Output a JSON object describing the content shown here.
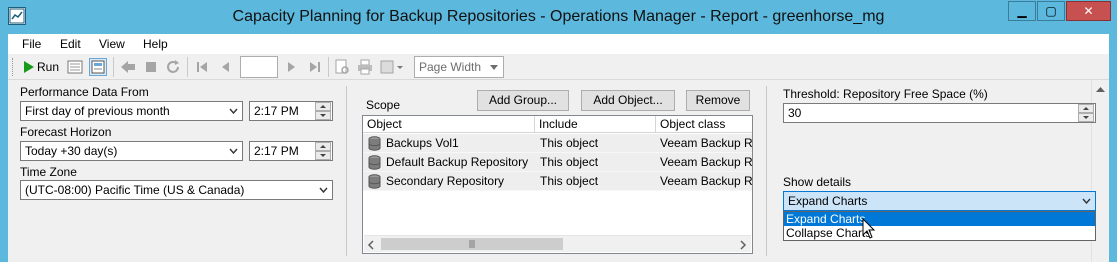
{
  "window": {
    "title": "Capacity Planning for Backup Repositories - Operations Manager - Report - greenhorse_mg",
    "minimize": "▁",
    "maximize": "▢",
    "close": "✕"
  },
  "menu": [
    "File",
    "Edit",
    "View",
    "Help"
  ],
  "toolbar": {
    "run_label": "Run",
    "page_number": "",
    "zoom_value": "Page Width"
  },
  "left_panel": {
    "perf_label": "Performance Data From",
    "perf_value": "First day of previous month",
    "perf_time": "2:17 PM",
    "forecast_label": "Forecast Horizon",
    "forecast_value": "Today +30 day(s)",
    "forecast_time": "2:17 PM",
    "tz_label": "Time Zone",
    "tz_value": "(UTC-08:00) Pacific Time (US & Canada)"
  },
  "scope": {
    "label": "Scope",
    "add_group": "Add Group...",
    "add_object": "Add Object...",
    "remove": "Remove",
    "columns": [
      "Object",
      "Include",
      "Object class"
    ],
    "rows": [
      {
        "object": "Backups Vol1",
        "include": "This object",
        "class": "Veeam Backup R..."
      },
      {
        "object": "Default Backup Repository",
        "include": "This object",
        "class": "Veeam Backup R..."
      },
      {
        "object": "Secondary Repository",
        "include": "This object",
        "class": "Veeam Backup R..."
      }
    ]
  },
  "right_panel": {
    "threshold_label": "Threshold: Repository Free Space (%)",
    "threshold_value": "30",
    "details_label": "Show details",
    "details_value": "Expand Charts",
    "details_options": [
      "Expand Charts",
      "Collapse Charts"
    ]
  },
  "colors": {
    "titlebar": "#5cb8dc",
    "selection": "#0078d7",
    "run_green": "#1a9a1a"
  }
}
